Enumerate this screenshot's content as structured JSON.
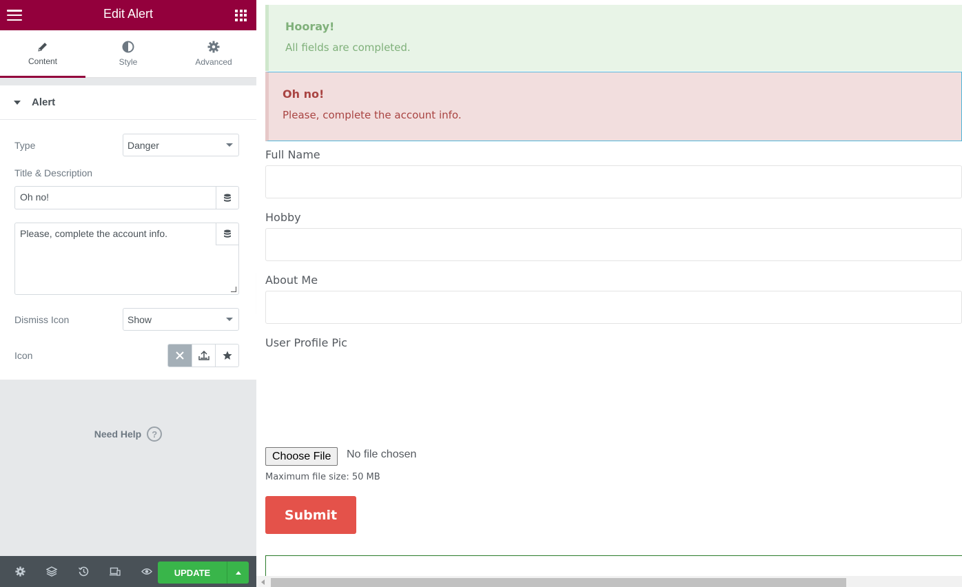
{
  "header": {
    "title": "Edit Alert"
  },
  "tabs": [
    {
      "label": "Content",
      "icon": "pencil-icon",
      "active": true
    },
    {
      "label": "Style",
      "icon": "contrast-icon"
    },
    {
      "label": "Advanced",
      "icon": "gear-icon"
    }
  ],
  "section": {
    "title": "Alert"
  },
  "controls": {
    "type_label": "Type",
    "type_value": "Danger",
    "title_desc_label": "Title & Description",
    "title_value": "Oh no!",
    "description_value": "Please, complete the account info.",
    "dismiss_label": "Dismiss Icon",
    "dismiss_value": "Show",
    "icon_label": "Icon"
  },
  "help": {
    "label": "Need Help",
    "icon_text": "?"
  },
  "footer": {
    "update_label": "UPDATE"
  },
  "preview": {
    "alert_success": {
      "title": "Hooray!",
      "description": "All fields are completed."
    },
    "alert_danger": {
      "title": "Oh no!",
      "description": "Please, complete the account info."
    },
    "fields": {
      "full_name": "Full Name",
      "hobby": "Hobby",
      "about_me": "About Me",
      "profile_pic": "User Profile Pic"
    },
    "file": {
      "button": "Choose File",
      "status": "No file chosen",
      "max_size": "Maximum file size: 50 MB"
    },
    "submit_label": "Submit"
  },
  "colors": {
    "brand": "#93003c",
    "update": "#39b54a",
    "submit": "#e4524a"
  }
}
